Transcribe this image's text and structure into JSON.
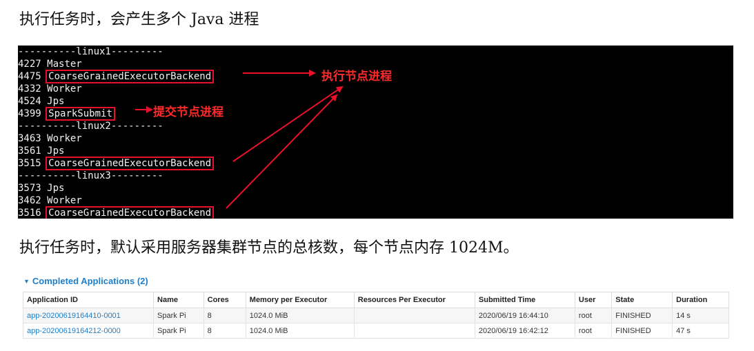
{
  "heading1": "执行任务时，会产生多个 Java 进程",
  "terminal": {
    "lines": [
      {
        "text": "----------linux1---------"
      },
      {
        "pid": "4227",
        "proc": "Master"
      },
      {
        "pid": "4475",
        "proc": "CoarseGrainedExecutorBackend",
        "highlight": true
      },
      {
        "pid": "4332",
        "proc": "Worker"
      },
      {
        "pid": "4524",
        "proc": "Jps"
      },
      {
        "pid": "4399",
        "proc": "SparkSubmit",
        "highlight": true
      },
      {
        "text": "----------linux2---------"
      },
      {
        "pid": "3463",
        "proc": "Worker"
      },
      {
        "pid": "3561",
        "proc": "Jps"
      },
      {
        "pid": "3515",
        "proc": "CoarseGrainedExecutorBackend",
        "highlight": true
      },
      {
        "text": "----------linux3---------"
      },
      {
        "pid": "3573",
        "proc": "Jps"
      },
      {
        "pid": "3462",
        "proc": "Worker"
      },
      {
        "pid": "3516",
        "proc": "CoarseGrainedExecutorBackend",
        "highlight": true
      }
    ],
    "callout_executor": "执行节点进程",
    "callout_submit": "提交节点进程",
    "accent_color": "#e8102a"
  },
  "heading2": "执行任务时，默认采用服务器集群节点的总核数，每个节点内存 1024M。",
  "completed": {
    "title": "Completed Applications (2)",
    "columns": [
      "Application ID",
      "Name",
      "Cores",
      "Memory per Executor",
      "Resources Per Executor",
      "Submitted Time",
      "User",
      "State",
      "Duration"
    ],
    "rows": [
      [
        "app-20200619164410-0001",
        "Spark Pi",
        "8",
        "1024.0 MiB",
        "",
        "2020/06/19 16:44:10",
        "root",
        "FINISHED",
        "14 s"
      ],
      [
        "app-20200619164212-0000",
        "Spark Pi",
        "8",
        "1024.0 MiB",
        "",
        "2020/06/19 16:42:12",
        "root",
        "FINISHED",
        "47 s"
      ]
    ]
  }
}
